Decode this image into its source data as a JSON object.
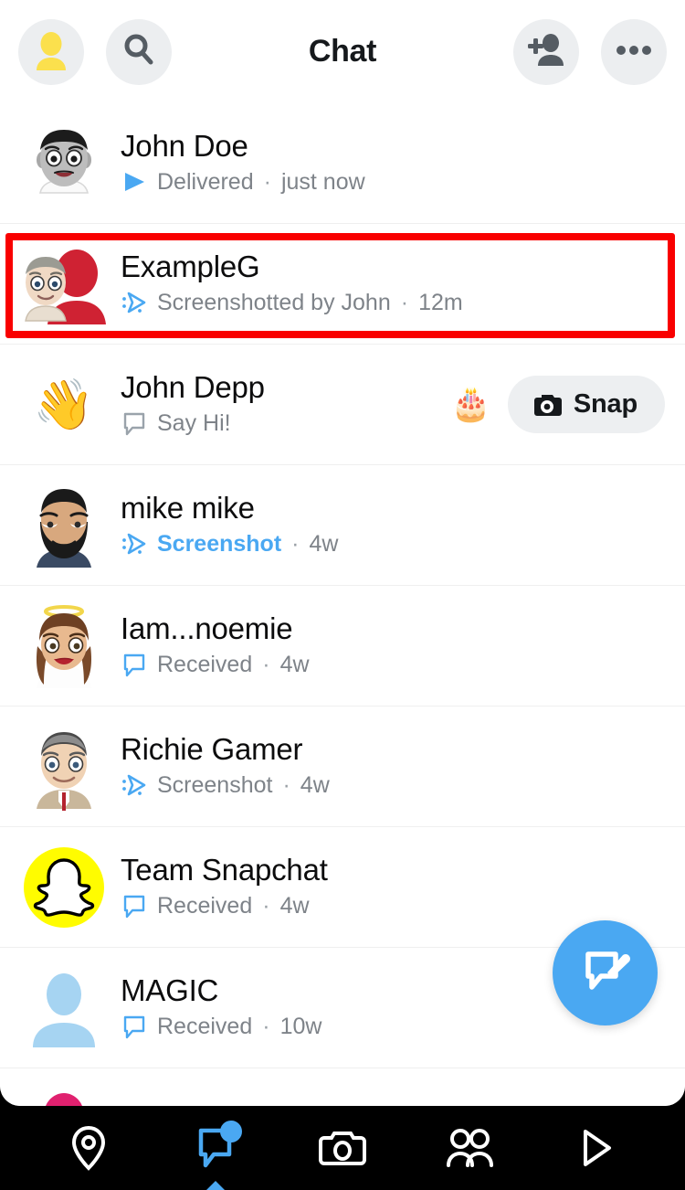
{
  "header": {
    "title": "Chat",
    "profile_icon": "profile-avatar-icon",
    "search_icon": "search-icon",
    "add_friend_icon": "add-friend-icon",
    "more_icon": "more-options-icon"
  },
  "chats": [
    {
      "name": "John Doe",
      "status": "Delivered",
      "time": "just now",
      "status_icon": "delivered-arrow-icon",
      "unread": false,
      "avatar": "bitmoji-grayscale-male",
      "highlighted": false
    },
    {
      "name": "ExampleG",
      "status": "Screenshotted by John",
      "time": "12m",
      "status_icon": "screenshot-arrow-icon",
      "unread": false,
      "avatar": "group-bitmoji-red",
      "highlighted": true
    },
    {
      "name": "John Depp",
      "status": "Say Hi!",
      "time": "",
      "status_icon": "chat-bubble-outline-icon",
      "unread": false,
      "avatar": "waving-hand-emoji",
      "highlighted": false,
      "birthday_emoji": "🎂",
      "action_label": "Snap",
      "action_icon": "camera-icon"
    },
    {
      "name": "mike mike",
      "status": "Screenshot",
      "time": "4w",
      "status_icon": "screenshot-arrow-icon",
      "unread": true,
      "avatar": "bitmoji-bearded-male",
      "highlighted": false
    },
    {
      "name": "Iam...noemie",
      "status": "Received",
      "time": "4w",
      "status_icon": "chat-bubble-outline-icon",
      "unread": false,
      "avatar": "bitmoji-female-halo",
      "highlighted": false
    },
    {
      "name": "Richie Gamer",
      "status": "Screenshot",
      "time": "4w",
      "status_icon": "screenshot-arrow-icon",
      "unread": false,
      "avatar": "bitmoji-grey-hair-male",
      "highlighted": false
    },
    {
      "name": "Team Snapchat",
      "status": "Received",
      "time": "4w",
      "status_icon": "chat-bubble-outline-icon",
      "unread": false,
      "avatar": "snapchat-ghost-logo",
      "highlighted": false
    },
    {
      "name": "MAGIC",
      "status": "Received",
      "time": "10w",
      "status_icon": "chat-bubble-outline-icon",
      "unread": false,
      "avatar": "default-silhouette-blue",
      "highlighted": false
    }
  ],
  "separator": "·",
  "compose_button": {
    "icon": "new-chat-compose-icon"
  },
  "bottom_nav": [
    {
      "name": "map",
      "icon": "location-pin-icon",
      "active": false,
      "badge": false
    },
    {
      "name": "chat",
      "icon": "chat-bubble-icon",
      "active": true,
      "badge": true
    },
    {
      "name": "camera",
      "icon": "camera-icon",
      "active": false,
      "badge": false
    },
    {
      "name": "friends",
      "icon": "friends-icon",
      "active": false,
      "badge": false
    },
    {
      "name": "stories",
      "icon": "play-arrow-icon",
      "active": false,
      "badge": false
    }
  ],
  "colors": {
    "accent_blue": "#4aa8f2",
    "highlight_red": "#f90000",
    "snapchat_yellow": "#fffc00",
    "text_primary": "#0c0c0d",
    "text_secondary": "#7e8389"
  }
}
